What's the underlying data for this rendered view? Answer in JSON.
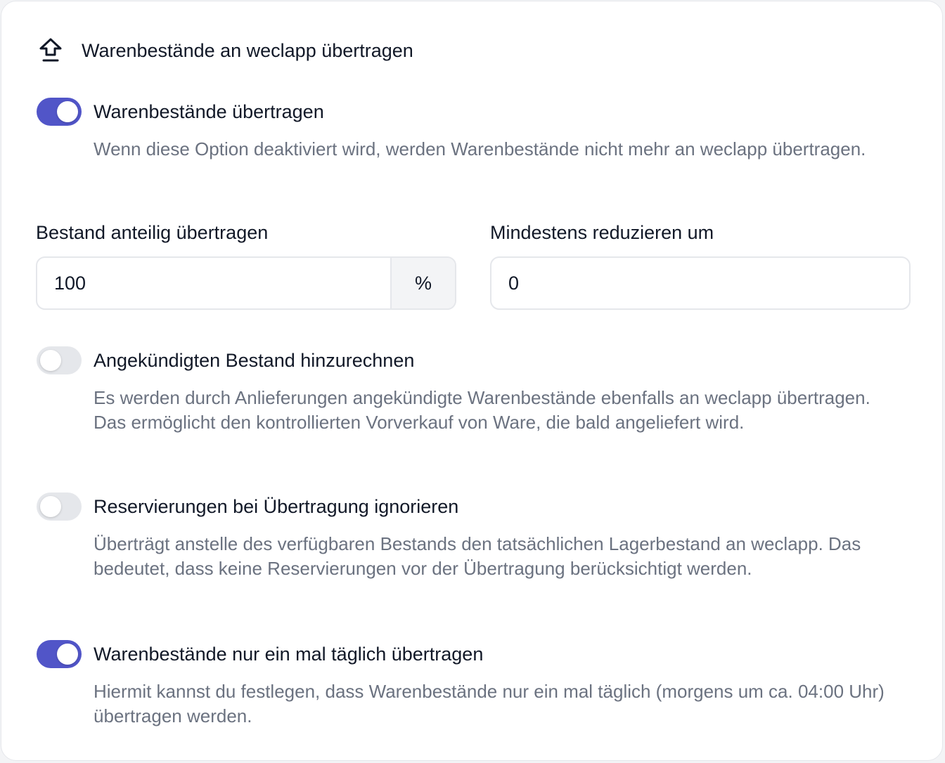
{
  "header": {
    "icon": "upload-arrow-icon",
    "title": "Warenbestände an weclapp übertragen"
  },
  "settings": [
    {
      "label": "Warenbestände übertragen",
      "enabled": true,
      "description": "Wenn diese Option deaktiviert wird, werden Warenbestände nicht mehr an weclapp übertragen."
    },
    {
      "label": "Angekündigten Bestand hinzurechnen",
      "enabled": false,
      "description": "Es werden durch Anlieferungen angekündigte Warenbestände ebenfalls an weclapp übertragen. Das ermöglicht den kontrollierten Vorverkauf von Ware, die bald angeliefert wird."
    },
    {
      "label": "Reservierungen bei Übertragung ignorieren",
      "enabled": false,
      "description": "Überträgt anstelle des verfügbaren Bestands den tatsächlichen Lagerbestand an weclapp. Das bedeutet, dass keine Reservierungen vor der Übertragung berücksichtigt werden."
    },
    {
      "label": "Warenbestände nur ein mal täglich übertragen",
      "enabled": true,
      "description": "Hiermit kannst du festlegen, dass Warenbestände nur ein mal täglich (morgens um ca. 04:00 Uhr) übertragen werden."
    }
  ],
  "fields": {
    "share": {
      "label": "Bestand anteilig übertragen",
      "value": "100",
      "suffix": "%"
    },
    "min_reduce": {
      "label": "Mindestens reduzieren um",
      "value": "0"
    }
  },
  "colors": {
    "accent": "#5155c8",
    "toggle_off": "#e5e7eb",
    "muted_text": "#6b7280"
  }
}
